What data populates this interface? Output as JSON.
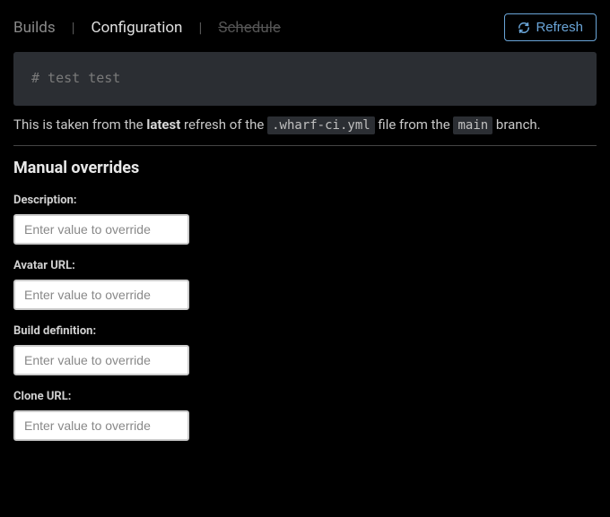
{
  "tabs": {
    "builds": "Builds",
    "configuration": "Configuration",
    "schedule": "Schedule"
  },
  "refresh": {
    "label": "Refresh"
  },
  "code": {
    "content": "# test test"
  },
  "info": {
    "prefix": "This is taken from the ",
    "latest": "latest",
    "mid1": " refresh of the ",
    "file": ".wharf-ci.yml",
    "mid2": " file from the ",
    "branch": "main",
    "suffix": " branch."
  },
  "section": {
    "title": "Manual overrides"
  },
  "fields": {
    "description": {
      "label": "Description:",
      "placeholder": "Enter value to override"
    },
    "avatarUrl": {
      "label": "Avatar URL:",
      "placeholder": "Enter value to override"
    },
    "buildDefinition": {
      "label": "Build definition:",
      "placeholder": "Enter value to override"
    },
    "cloneUrl": {
      "label": "Clone URL:",
      "placeholder": "Enter value to override"
    }
  }
}
